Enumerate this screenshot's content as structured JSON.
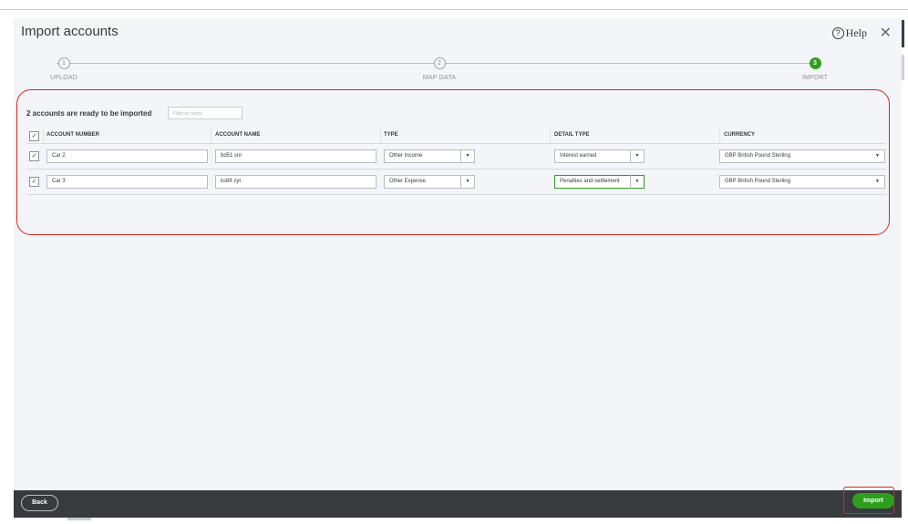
{
  "dialog": {
    "title": "Import accounts",
    "help_label": "Help",
    "help_glyph": "?",
    "close_glyph": "✕"
  },
  "steps": [
    {
      "number": "1",
      "label": "UPLOAD",
      "active": false
    },
    {
      "number": "2",
      "label": "MAP DATA",
      "active": false
    },
    {
      "number": "3",
      "label": "IMPORT",
      "active": true
    }
  ],
  "summary": {
    "ready_text": "2 accounts are ready to be imported",
    "filter_placeholder": "Filter by name"
  },
  "table": {
    "columns": [
      "ACCOUNT NUMBER",
      "ACCOUNT NAME",
      "TYPE",
      "DETAIL TYPE",
      "CURRENCY"
    ],
    "header_checked": true,
    "rows": [
      {
        "checked": true,
        "account_number": "Car 2",
        "account_name": "bd51 snr",
        "type": "Other Income",
        "detail_type": "Interest earned",
        "currency": "GBP British Pound Sterling"
      },
      {
        "checked": true,
        "account_number": "Car 3",
        "account_name": "ks88 zyt",
        "type": "Other Expense",
        "detail_type": "Penalties and settlement",
        "currency": "GBP British Pound Sterling"
      }
    ]
  },
  "footer": {
    "back_label": "Back",
    "import_label": "Import"
  },
  "colors": {
    "accent_green": "#2ca01c",
    "annotation_red": "#d52b1e",
    "footer_bg": "#393a3d"
  },
  "icons": {
    "checkbox_checked": "✓",
    "dropdown": "▼"
  }
}
